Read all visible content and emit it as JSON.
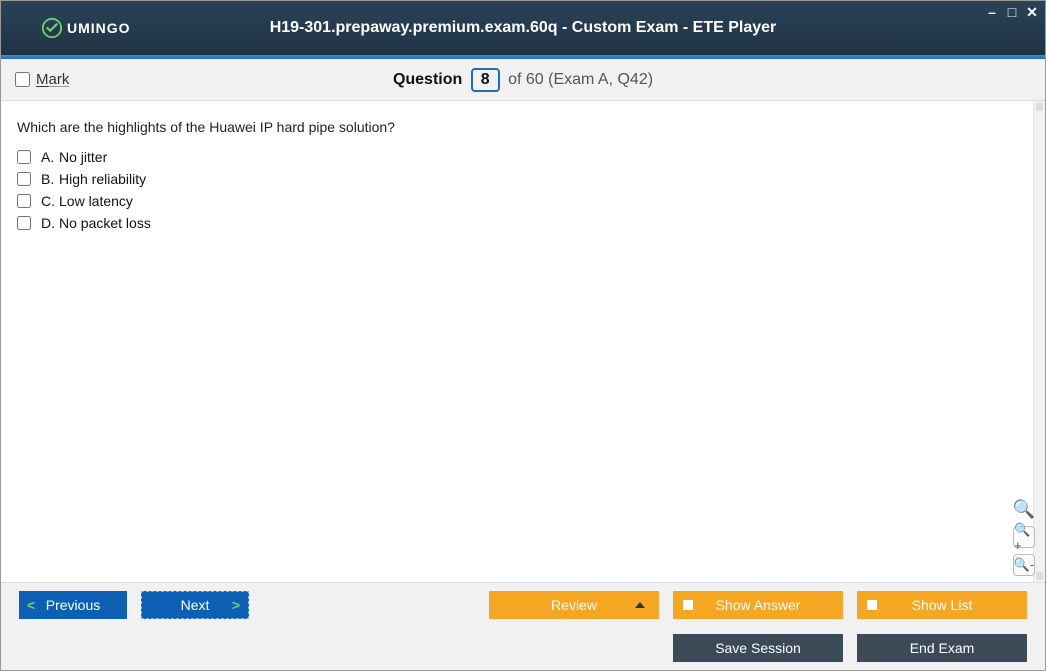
{
  "title": "H19-301.prepaway.premium.exam.60q - Custom Exam - ETE Player",
  "brand": "UMINGO",
  "mark_label": "Mark",
  "question_header": {
    "prefix": "Question",
    "number": "8",
    "suffix": "of 60 (Exam A, Q42)"
  },
  "question_text": "Which are the highlights of the Huawei IP hard pipe solution?",
  "options": [
    {
      "letter": "A.",
      "text": "No jitter"
    },
    {
      "letter": "B.",
      "text": "High reliability"
    },
    {
      "letter": "C.",
      "text": "Low latency"
    },
    {
      "letter": "D.",
      "text": "No packet loss"
    }
  ],
  "buttons": {
    "previous": "Previous",
    "next": "Next",
    "review": "Review",
    "show_answer": "Show Answer",
    "show_list": "Show List",
    "save_session": "Save Session",
    "end_exam": "End Exam"
  }
}
